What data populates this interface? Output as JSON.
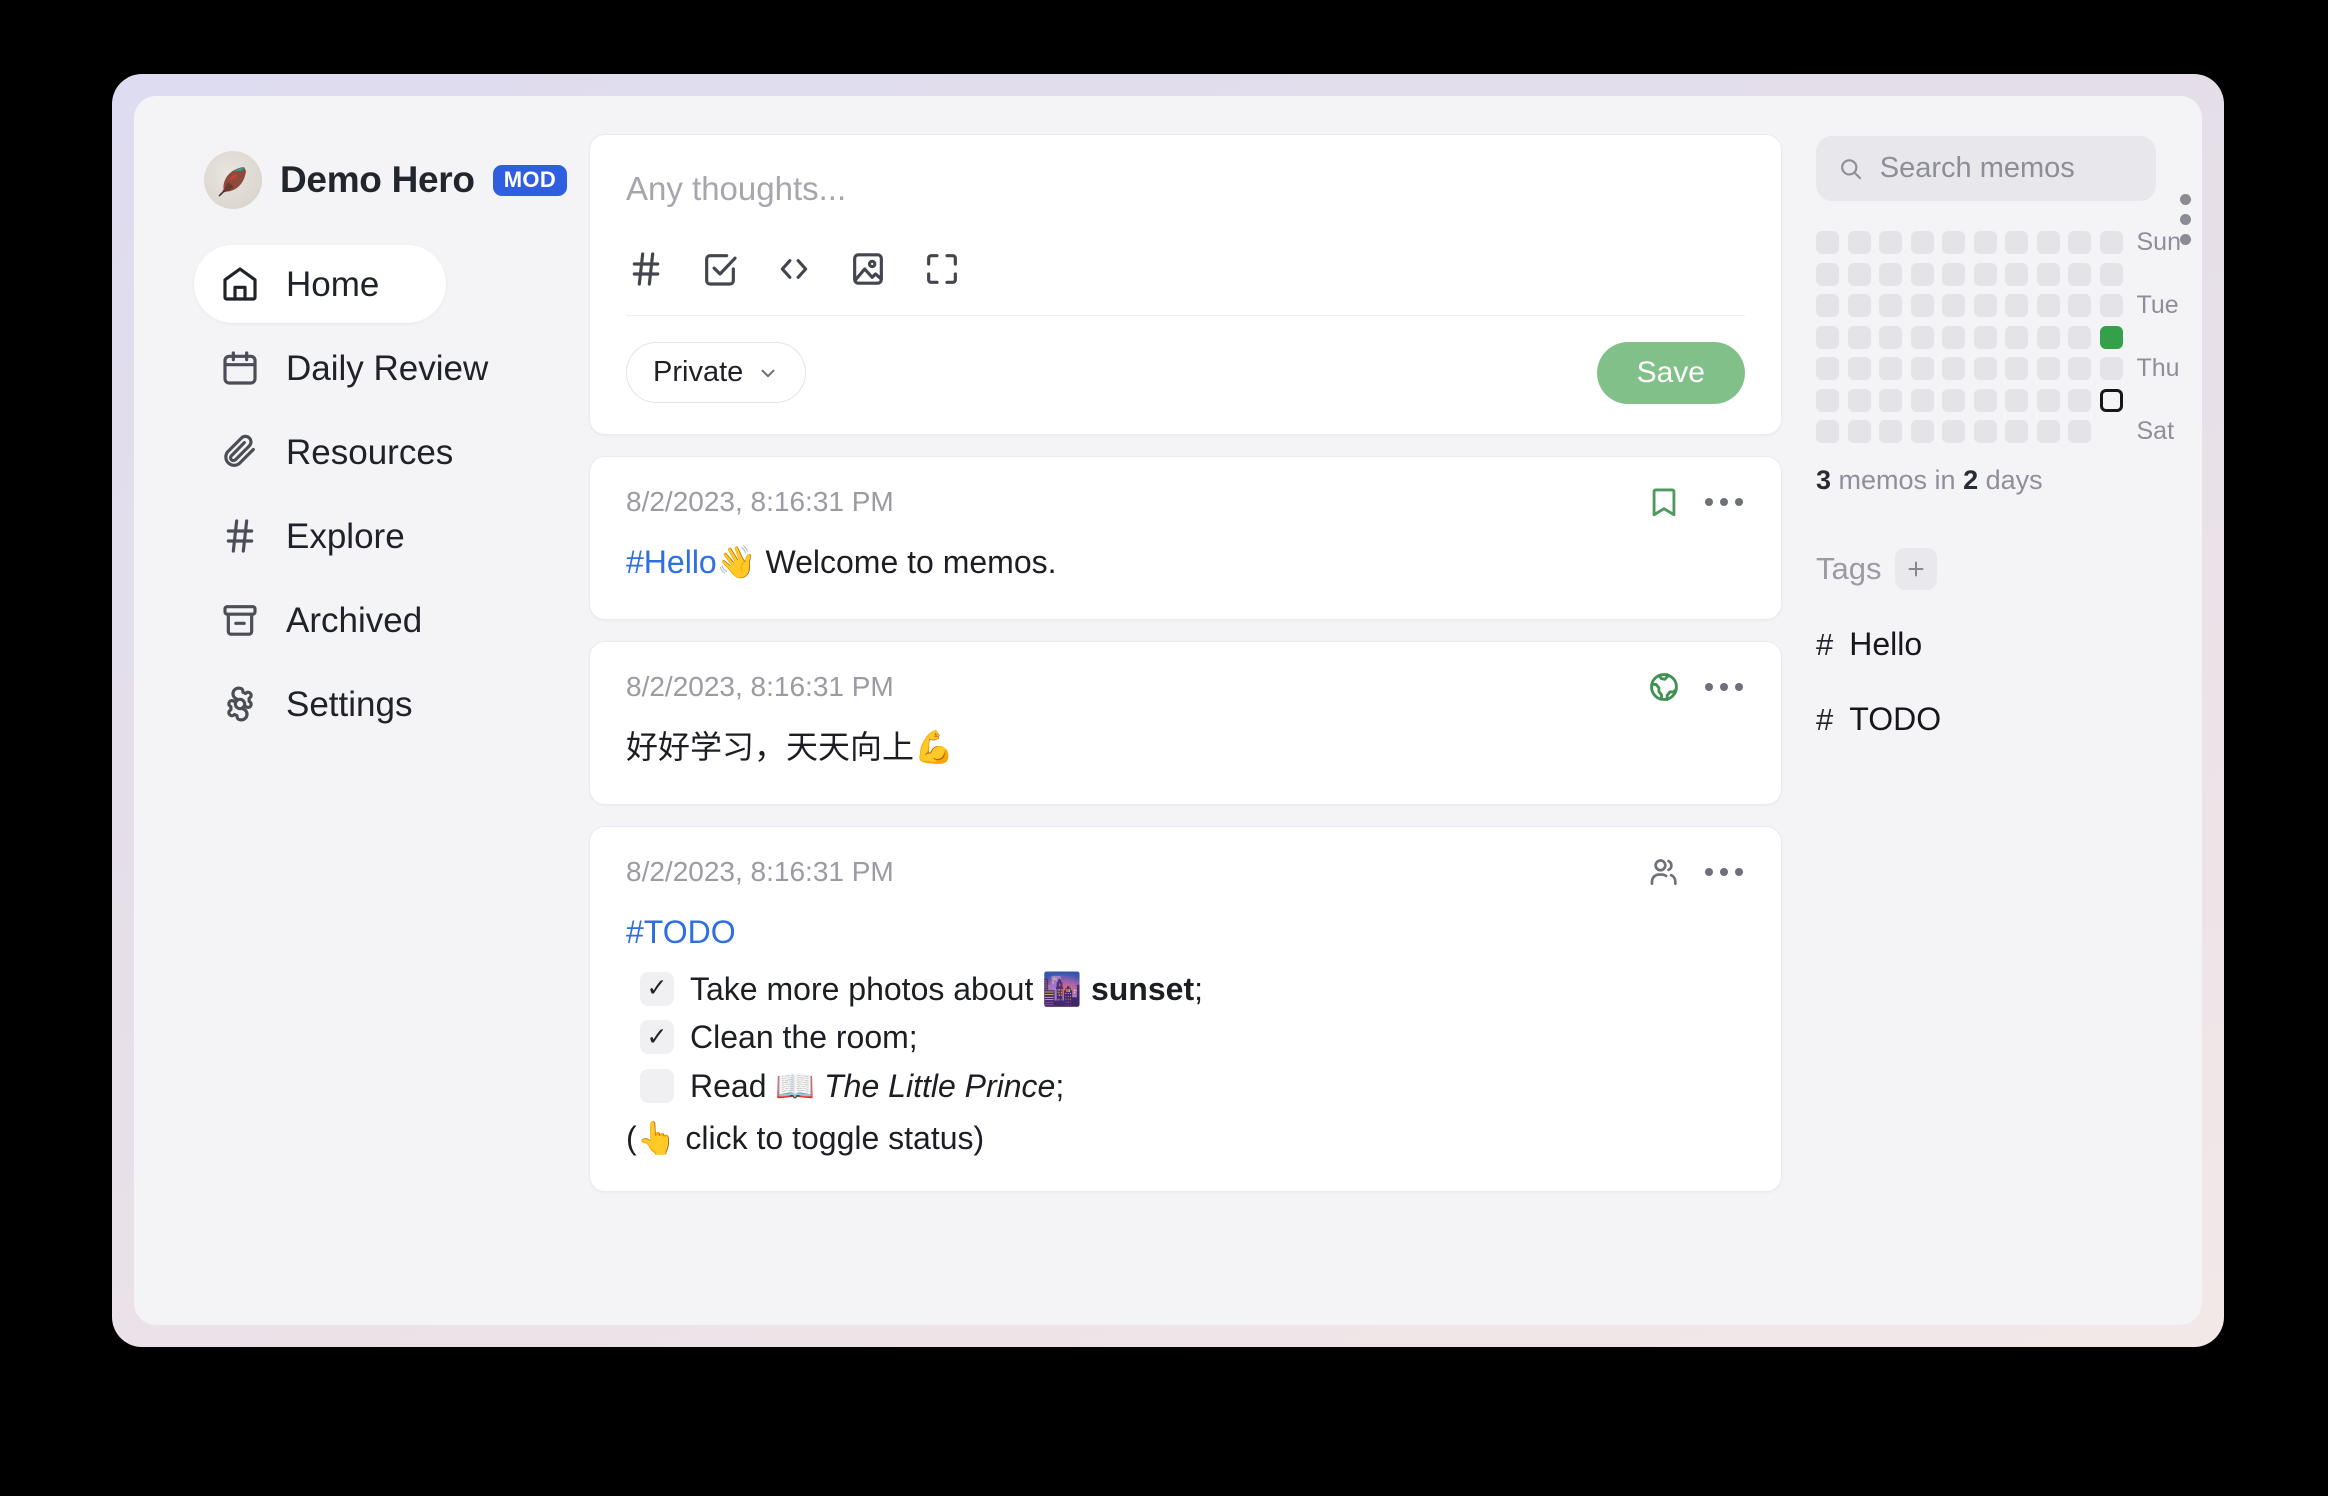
{
  "app": {
    "brand_name": "Demo Hero",
    "badge": "MOD",
    "avatar_icon": "feather-quill-avatar"
  },
  "sidebar": {
    "items": [
      {
        "label": "Home",
        "icon": "home-icon",
        "active": true
      },
      {
        "label": "Daily Review",
        "icon": "calendar-icon",
        "active": false
      },
      {
        "label": "Resources",
        "icon": "paperclip-icon",
        "active": false
      },
      {
        "label": "Explore",
        "icon": "hash-icon",
        "active": false
      },
      {
        "label": "Archived",
        "icon": "archive-icon",
        "active": false
      },
      {
        "label": "Settings",
        "icon": "gear-icon",
        "active": false
      }
    ]
  },
  "editor": {
    "placeholder": "Any thoughts...",
    "tools": [
      {
        "name": "hash-icon"
      },
      {
        "name": "check-square-icon"
      },
      {
        "name": "code-icon"
      },
      {
        "name": "image-icon"
      },
      {
        "name": "fullscreen-icon"
      }
    ],
    "visibility_label": "Private",
    "save_label": "Save"
  },
  "memos": [
    {
      "time": "8/2/2023, 8:16:31 PM",
      "visibility_icon": "bookmark-icon",
      "visibility_color": "#4e9b5c",
      "tag": "#Hello",
      "emoji": "👋",
      "text": "Welcome to memos."
    },
    {
      "time": "8/2/2023, 8:16:31 PM",
      "visibility_icon": "globe-icon",
      "visibility_color": "#3f9350",
      "text": "好好学习，天天向上💪"
    },
    {
      "time": "8/2/2023, 8:16:31 PM",
      "visibility_icon": "users-icon",
      "visibility_color": "#6e707a",
      "tag": "#TODO",
      "todos": [
        {
          "checked": true,
          "prefix": "Take more photos about ",
          "emoji": "🌆",
          "bold": "sunset",
          "suffix": ";"
        },
        {
          "checked": true,
          "prefix": "Clean the room;",
          "emoji": "",
          "bold": "",
          "suffix": ""
        },
        {
          "checked": false,
          "prefix": "Read ",
          "emoji": "📖",
          "italic": "The Little Prince",
          "suffix": ";"
        }
      ],
      "note": "(👆 click to toggle status)"
    }
  ],
  "right": {
    "search_placeholder": "Search memos",
    "day_labels": [
      "Sun",
      "",
      "Tue",
      "",
      "Thu",
      "",
      "Sat"
    ],
    "heatmap": {
      "columns": 10,
      "rows": 7,
      "green_cells": [
        [
          3,
          9
        ]
      ],
      "today_cell": [
        5,
        9
      ],
      "empty_cells": [
        [
          6,
          9
        ]
      ]
    },
    "stat_count": "3",
    "stat_mid": " memos in ",
    "stat_days": "2",
    "stat_suffix": " days",
    "tags_title": "Tags",
    "tags": [
      {
        "hash": "#",
        "label": "Hello"
      },
      {
        "hash": "#",
        "label": "TODO"
      }
    ]
  }
}
